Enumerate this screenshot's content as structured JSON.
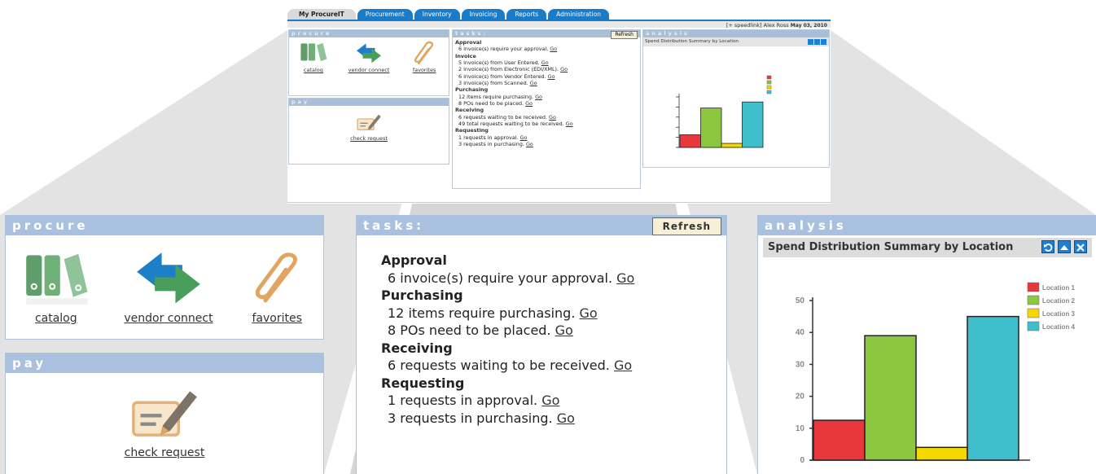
{
  "mini": {
    "tabs": [
      "My ProcureIT",
      "Procurement",
      "Inventory",
      "Invoicing",
      "Reports",
      "Administration"
    ],
    "userbar": {
      "user": "[+ speedlink] Alex Ross",
      "date": "May 03, 2010"
    },
    "procure_title": "procure",
    "pay_title": "pay",
    "tasks_title": "tasks:",
    "analysis_title": "analysis",
    "refresh": "Refresh",
    "icons": [
      "catalog",
      "vendor connect",
      "favorites"
    ],
    "check_request": "check request",
    "chart_title": "Spend Distribution Summary by Location",
    "tasks": [
      {
        "h": "Approval"
      },
      {
        "i": "6 invoice(s) require your approval. ",
        "go": "Go"
      },
      {
        "h": "Invoice"
      },
      {
        "i": "5 invoice(s) from User Entered. ",
        "go": "Go"
      },
      {
        "i": "2 invoice(s) from Electronic (EDI/XML). ",
        "go": "Go"
      },
      {
        "i": "6 invoice(s) from Vendor Entered. ",
        "go": "Go"
      },
      {
        "i": "3 invoice(s) from Scanned. ",
        "go": "Go"
      },
      {
        "h": "Purchasing"
      },
      {
        "i": "12 items require purchasing. ",
        "go": "Go"
      },
      {
        "i": "8 POs need to be placed. ",
        "go": "Go"
      },
      {
        "h": "Receiving"
      },
      {
        "i": "6 requests waiting to be received. ",
        "go": "Go"
      },
      {
        "i": "49 total requests waiting to be received. ",
        "go": "Go"
      },
      {
        "h": "Requesting"
      },
      {
        "i": "1 requests in approval. ",
        "go": "Go"
      },
      {
        "i": "3 requests in purchasing. ",
        "go": "Go"
      }
    ]
  },
  "procure": {
    "title": "procure",
    "items": [
      {
        "label": "catalog",
        "icon": "binders-icon"
      },
      {
        "label": "vendor connect",
        "icon": "arrows-icon"
      },
      {
        "label": "favorites",
        "icon": "paperclip-icon"
      }
    ]
  },
  "pay": {
    "title": "pay",
    "item": {
      "label": "check request",
      "icon": "check-pen-icon"
    }
  },
  "tasks": {
    "title": "tasks:",
    "refresh": "Refresh",
    "lines": [
      {
        "h": "Approval"
      },
      {
        "i": "6 invoice(s) require your approval. ",
        "go": "Go"
      },
      {
        "h": "Purchasing"
      },
      {
        "i": "12 items require purchasing. ",
        "go": "Go"
      },
      {
        "i": "8 POs need to be placed. ",
        "go": "Go"
      },
      {
        "h": "Receiving"
      },
      {
        "i": "6 requests waiting to be received. ",
        "go": "Go"
      },
      {
        "h": "Requesting"
      },
      {
        "i": "1 requests in approval. ",
        "go": "Go"
      },
      {
        "i": "3 requests in purchasing. ",
        "go": "Go"
      }
    ]
  },
  "analysis": {
    "title": "analysis",
    "chart_title": "Spend Distribution Summary by Location",
    "controls": [
      "refresh-icon",
      "collapse-icon",
      "close-icon"
    ]
  },
  "colors": {
    "header": "#a9c1df",
    "tab_blue": "#1a7bc9",
    "loc1": "#e8383d",
    "loc2": "#8dc63f",
    "loc3": "#f5d800",
    "loc4": "#3fbfcb"
  },
  "chart_data": {
    "type": "bar",
    "categories": [
      "Location 1",
      "Location 2",
      "Location 3",
      "Location 4"
    ],
    "values": [
      12.5,
      39,
      4,
      45
    ],
    "title": "Spend Distribution Summary by Location",
    "xlabel": "",
    "ylabel": "",
    "ylim": [
      0,
      50
    ],
    "yticks": [
      0,
      10,
      20,
      30,
      40,
      50
    ],
    "legend": [
      "Location 1",
      "Location 2",
      "Location 3",
      "Location 4"
    ],
    "legend_position": "top-right",
    "grid": false
  }
}
